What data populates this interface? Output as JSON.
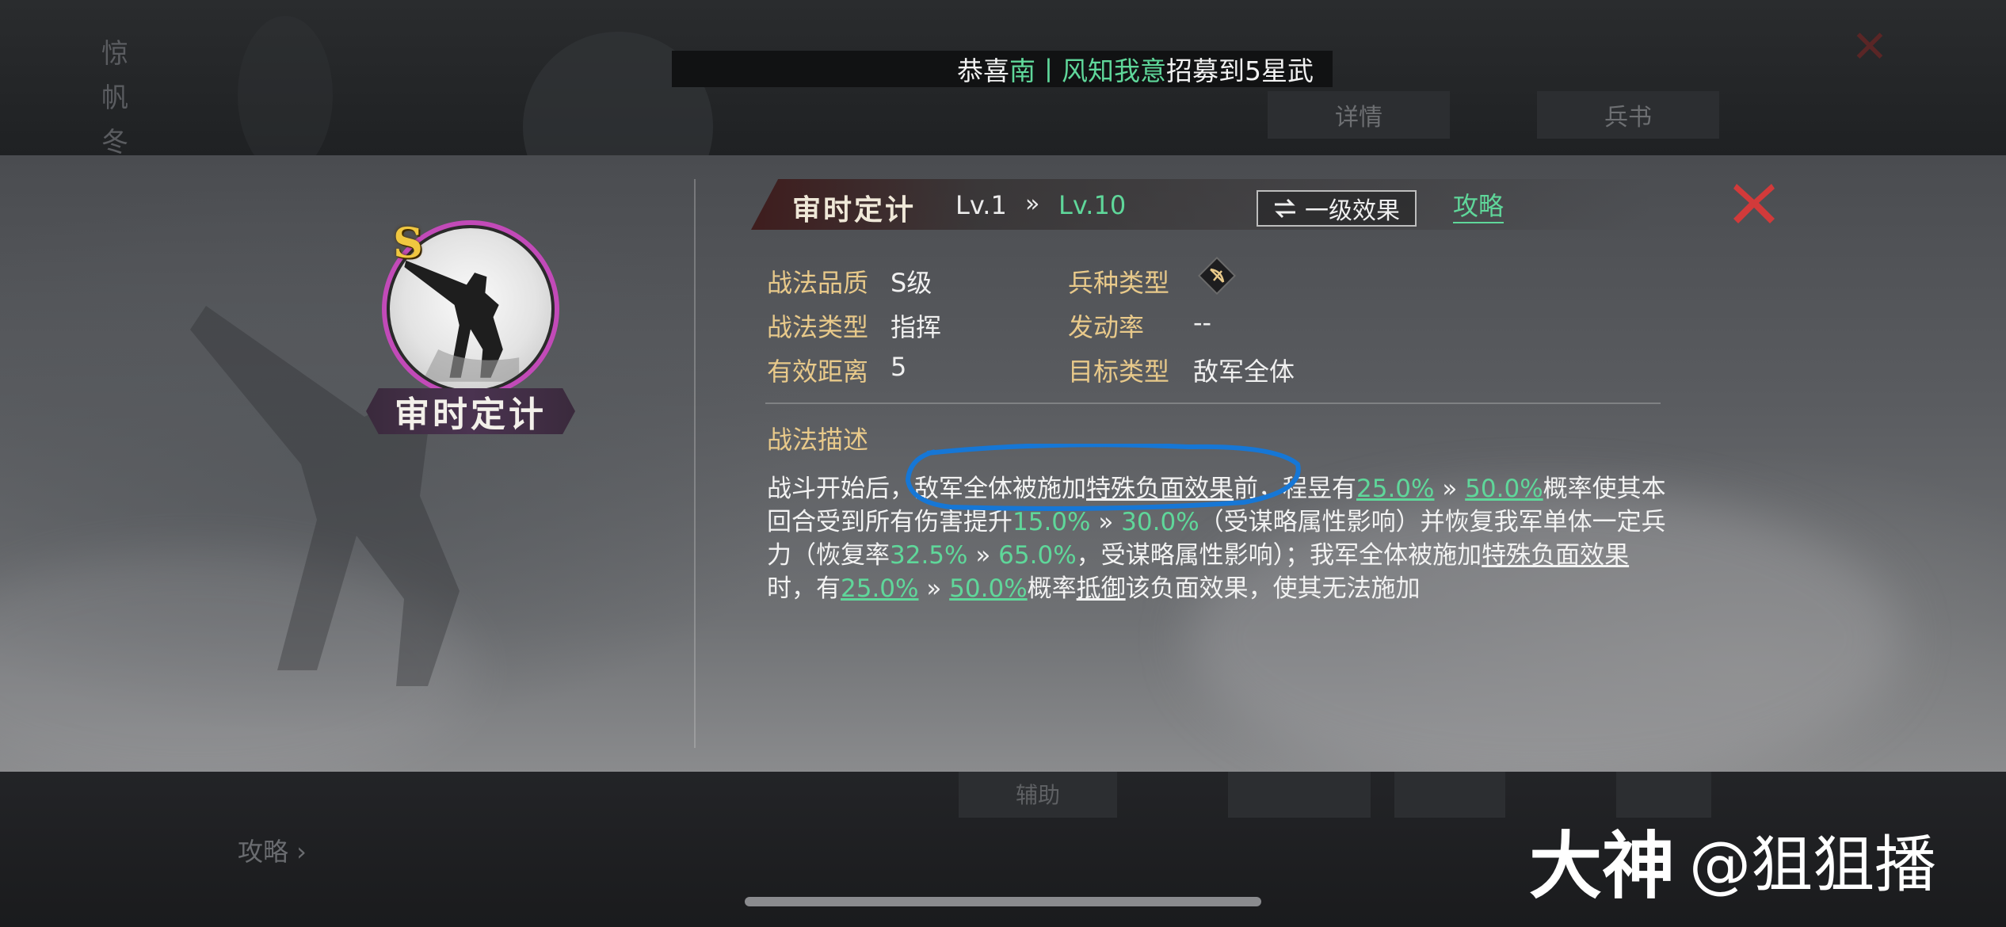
{
  "banner": {
    "prefix": "恭喜",
    "player": "南丨风知我意",
    "suffix": "招募到5星武"
  },
  "background": {
    "side_text": "惊 帆 冬",
    "tab_left": "详情",
    "tab_right": "兵书",
    "bottom_label": "攻略 ›",
    "bottom_btn_1": "辅助",
    "bottom_btn_2": "",
    "bottom_btn_3": ""
  },
  "skill": {
    "grade_badge": "S",
    "name_plate": "审时定计",
    "title": "审时定计",
    "level_from": "Lv.1",
    "level_arrow": "»",
    "level_to": "Lv.10",
    "effect_button": "一级效果",
    "effect_icon": "swap-arrows-icon",
    "guide_link": "攻略"
  },
  "info": {
    "quality_label": "战法品质",
    "quality_value": "S级",
    "troop_label": "兵种类型",
    "troop_icon": "bow-icon",
    "type_label": "战法类型",
    "type_value": "指挥",
    "rate_label": "发动率",
    "rate_value": "--",
    "range_label": "有效距离",
    "range_value": "5",
    "target_label": "目标类型",
    "target_value": "敌军全体"
  },
  "description": {
    "title": "战法描述",
    "p1": "战斗开始后，",
    "p2": "敌军全体被施加",
    "p3": "特殊负面效果",
    "p4": "前，程昱有",
    "v1": "25.0%",
    "arrow": " » ",
    "v2": "50.0%",
    "p5": "概率使其本回合受到所有伤害提升",
    "v3": "15.0%",
    "v4": "30.0%",
    "p6": "（受谋略属性影响）并恢复我军单体一定兵力（恢复率",
    "v5": "32.5%",
    "v6": "65.0%",
    "p7": "，受谋略属性影响）；我军全体被施加",
    "p8": "特殊负面效果",
    "p9": "时，有",
    "v7": "25.0%",
    "v8": "50.0%",
    "p10": "概率",
    "p11": "抵御",
    "p12": "该负面效果，使其无法施加"
  },
  "watermark": {
    "logo": "大神",
    "user": "@狙狙播"
  },
  "colors": {
    "accent_green": "#5fd79a",
    "label_gold": "#e8c98a",
    "close_red": "#d23a3a",
    "annotation_blue": "#1677d6"
  }
}
